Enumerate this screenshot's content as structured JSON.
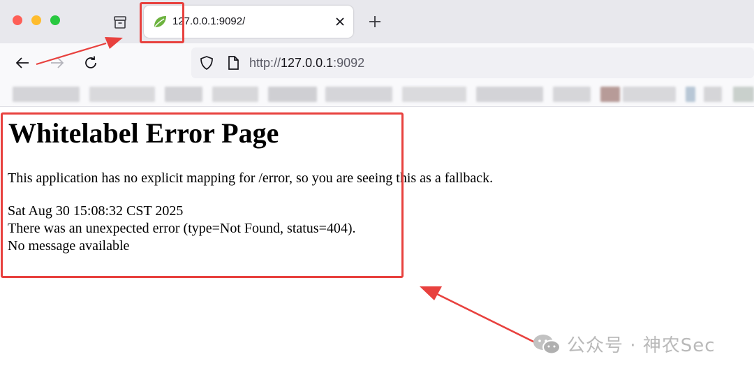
{
  "browser": {
    "tab": {
      "title": "127.0.0.1:9092/"
    },
    "address_bar": {
      "scheme": "http://",
      "host": "127.0.0.1",
      "port": ":9092"
    }
  },
  "page": {
    "heading": "Whitelabel Error Page",
    "message": "This application has no explicit mapping for /error, so you are seeing this as a fallback.",
    "timestamp": "Sat Aug 30 15:08:32 CST 2025",
    "error_line": "There was an unexpected error (type=Not Found, status=404).",
    "detail": "No message available"
  },
  "watermark": {
    "text": "公众号 · 神农Sec"
  },
  "icons": [
    "tab-overview-icon",
    "spring-leaf-icon",
    "close-icon",
    "plus-icon",
    "back-arrow-icon",
    "forward-arrow-icon",
    "reload-icon",
    "shield-icon",
    "page-icon",
    "wechat-icon"
  ],
  "colors": {
    "annotation": "#e8413e",
    "tab_strip": "#e8e8ed",
    "toolbar": "#f9f9fb",
    "urlbar": "#f0f0f4",
    "favicon": "#6db33f"
  }
}
